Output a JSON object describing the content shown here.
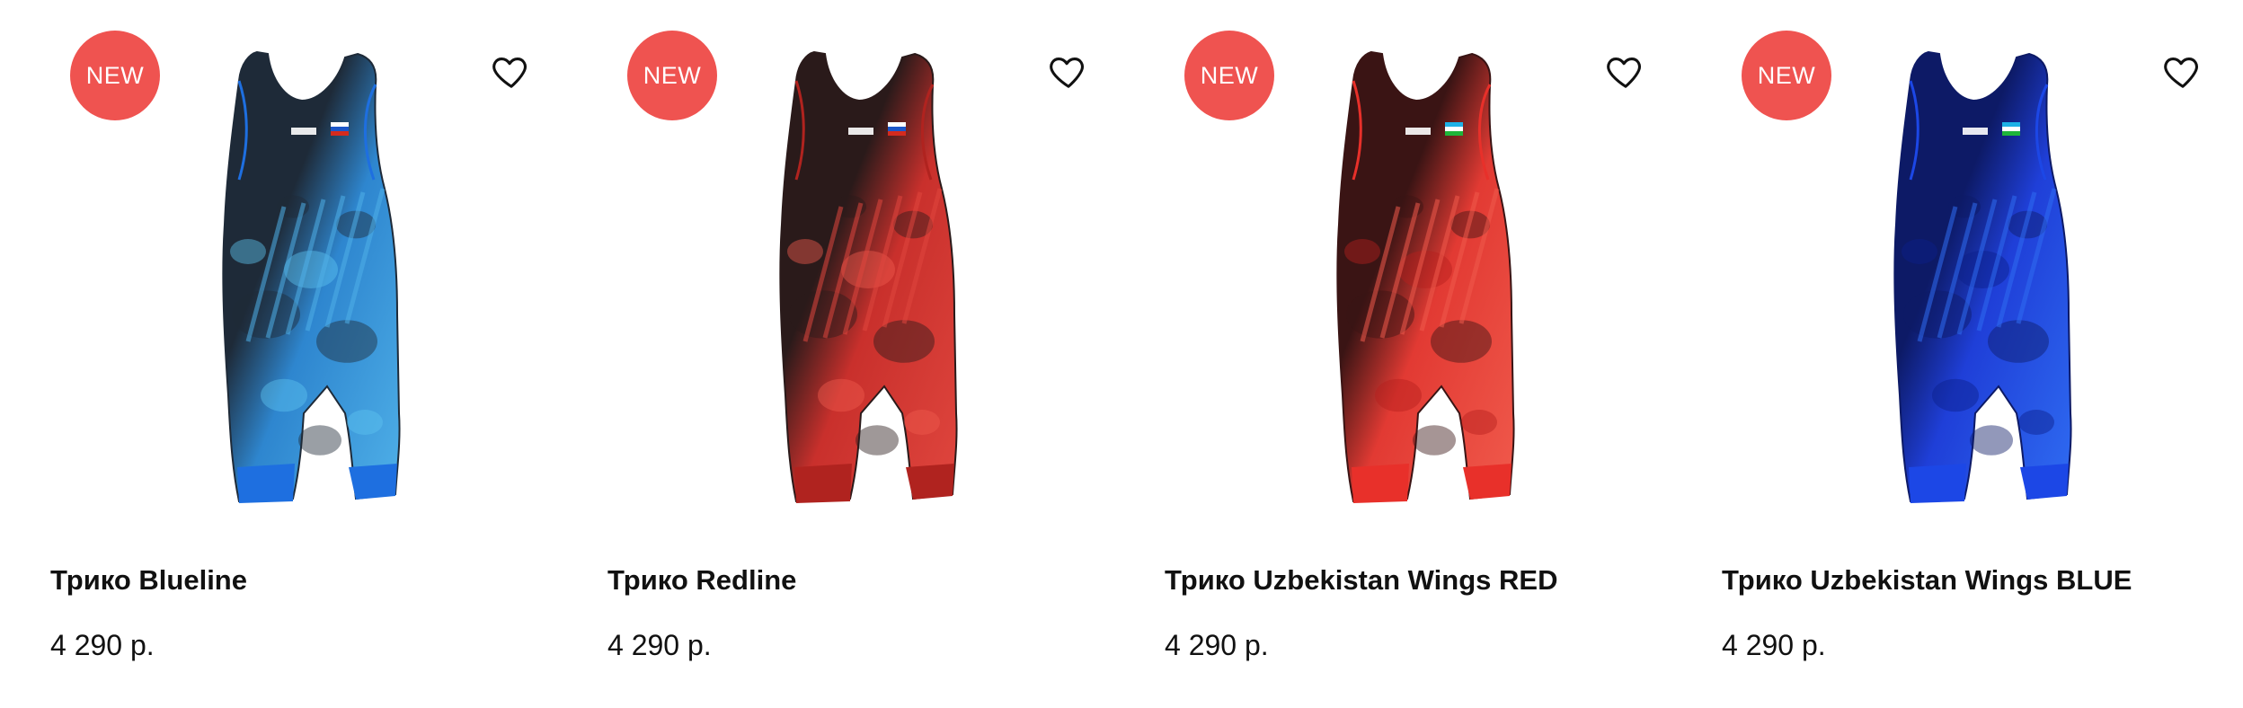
{
  "products": [
    {
      "badge": "NEW",
      "title": "Трико Blueline",
      "price": "4 290 р.",
      "flag": "russia",
      "colors": {
        "main": "#2e86cf",
        "light": "#4fb0e8",
        "dark": "#1e2a38",
        "trim": "#1e6fe0",
        "accent": "#5dc3f0"
      }
    },
    {
      "badge": "NEW",
      "title": "Трико Redline",
      "price": "4 290 р.",
      "flag": "russia",
      "colors": {
        "main": "#c9302c",
        "light": "#e0463e",
        "dark": "#2a1a1a",
        "trim": "#b0231f",
        "accent": "#ef5a4e"
      }
    },
    {
      "badge": "NEW",
      "title": "Трико Uzbekistan Wings RED",
      "price": "4 290 р.",
      "flag": "uzbekistan",
      "colors": {
        "main": "#e23a33",
        "light": "#f05a4c",
        "dark": "#3a1414",
        "trim": "#e8302a",
        "accent": "#b51f1c"
      }
    },
    {
      "badge": "NEW",
      "title": "Трико Uzbekistan Wings BLUE",
      "price": "4 290 р.",
      "flag": "uzbekistan",
      "colors": {
        "main": "#1f3fd8",
        "light": "#2f6cf2",
        "dark": "#0d1a66",
        "trim": "#1c47e6",
        "accent": "#0a1f8a"
      }
    }
  ],
  "icons": {
    "favorite": "heart-outline-icon"
  }
}
